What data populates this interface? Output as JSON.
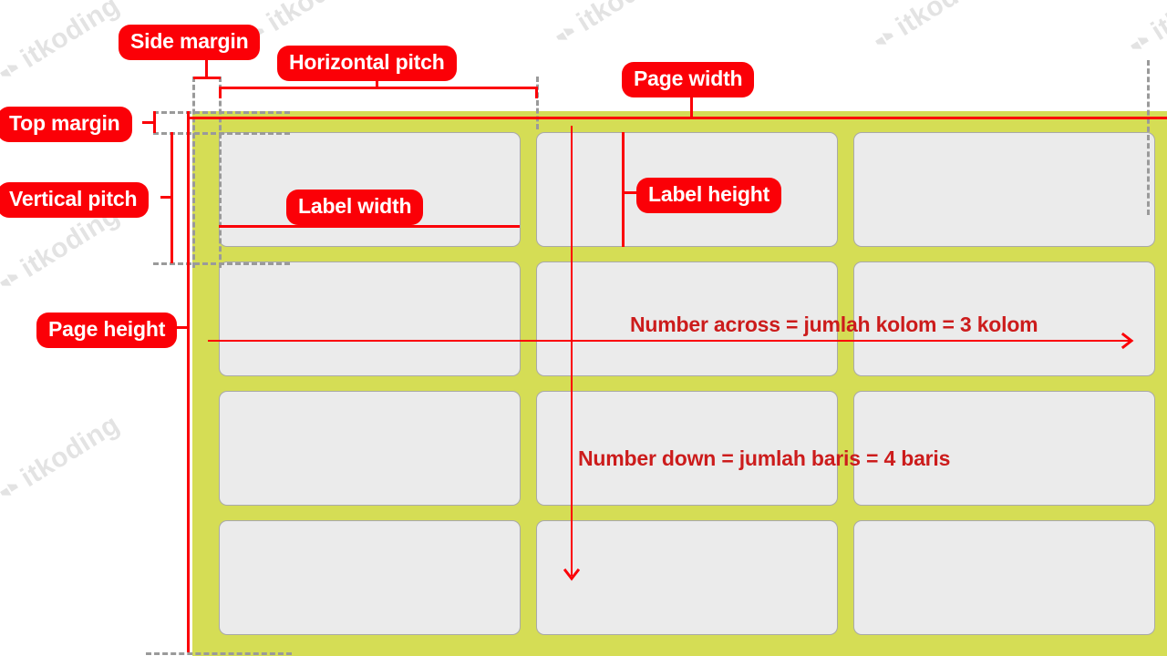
{
  "diagram": {
    "title": "Label sheet layout measurement diagram",
    "colors": {
      "page_fill": "#d5dd55",
      "label_fill": "#ebebeb",
      "label_border": "#a9a9a9",
      "measure_red": "#fb0007",
      "annotation_red": "#cc1c1c",
      "guide_gray": "#9a9a9a",
      "badge_text": "#ffffff",
      "watermark": "#e2e2e2",
      "background": "#ffffff"
    },
    "grid": {
      "columns": 3,
      "rows": 4
    }
  },
  "badges": [
    {
      "id": "side-margin",
      "label": "Side margin"
    },
    {
      "id": "horizontal-pitch",
      "label": "Horizontal pitch"
    },
    {
      "id": "page-width",
      "label": "Page width"
    },
    {
      "id": "top-margin",
      "label": "Top margin"
    },
    {
      "id": "label-height",
      "label": "Label height"
    },
    {
      "id": "vertical-pitch",
      "label": "Vertical pitch"
    },
    {
      "id": "label-width",
      "label": "Label width"
    },
    {
      "id": "page-height",
      "label": "Page height"
    }
  ],
  "annotations": [
    {
      "id": "number-across",
      "label": "Number across = jumlah kolom = 3 kolom"
    },
    {
      "id": "number-down",
      "label": "Number down = jumlah baris = 4 baris"
    }
  ],
  "watermark": {
    "text": "itkoding",
    "mark": "itkoding-logo-icon"
  }
}
